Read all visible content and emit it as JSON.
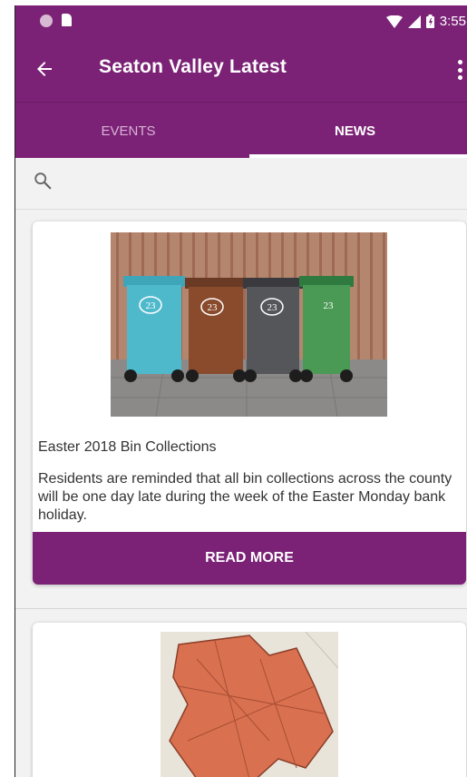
{
  "status_bar": {
    "time": "3:55",
    "icons": [
      "notification-dot-icon",
      "sd-card-icon",
      "wifi-icon",
      "signal-icon",
      "battery-icon"
    ]
  },
  "toolbar": {
    "title": "Seaton Valley Latest",
    "back_icon": "arrow-left-icon",
    "menu_icon": "more-vert-icon"
  },
  "tabs": [
    {
      "label": "EVENTS",
      "selected": false
    },
    {
      "label": "NEWS",
      "selected": true
    }
  ],
  "search": {
    "icon": "search-icon"
  },
  "news": [
    {
      "image": "wheelie-bins-photo",
      "bin_number": "23",
      "title": "Easter 2018 Bin Collections",
      "description": "Residents are reminded that all bin collections across the county will be one day late during the week of the Easter Monday bank holiday.",
      "action": "READ MORE"
    },
    {
      "image": "area-map"
    }
  ],
  "colors": {
    "primary": "#7b2276",
    "tab_inactive": "#d8b2d5",
    "background": "#f2f2f2"
  }
}
